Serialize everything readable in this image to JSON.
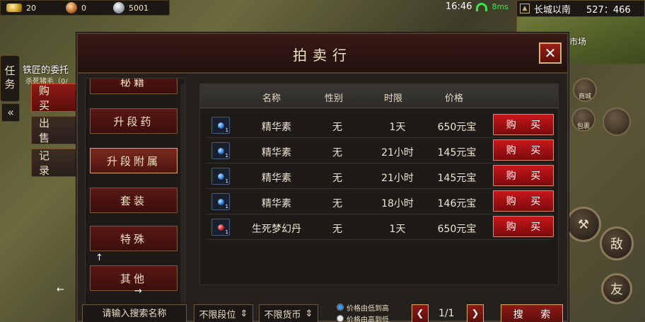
{
  "hud": {
    "gold": "20",
    "copper": "0",
    "silver": "5001",
    "time": "16:46",
    "ping": "8ms",
    "location": "长城以南",
    "coords": "527：466",
    "minimap_label": "市场"
  },
  "left": {
    "task_tab": "任务",
    "quest_title": "铁匠的委托",
    "quest_sub": "杀死猪毛（0/",
    "expand": "«",
    "tabs": [
      "购 买",
      "出 售",
      "记 录"
    ]
  },
  "right": {
    "icon1": "商城",
    "icon2": "包裹",
    "icon3": "",
    "enemy_btn": "敌",
    "friend_btn": "友"
  },
  "panel": {
    "title": "拍卖行",
    "close": "✕",
    "categories": [
      "秘籍",
      "升段药",
      "升段附属",
      "套装",
      "特殊",
      "其他"
    ],
    "arrow_up": "↑",
    "arrow_left": "←",
    "arrow_right": "→",
    "columns": [
      "名称",
      "性别",
      "时限",
      "价格"
    ],
    "rows": [
      {
        "qty": "1",
        "name": "精华素",
        "gender": "无",
        "time": "1天",
        "price": "650元宝",
        "buy": "购 买"
      },
      {
        "qty": "1",
        "name": "精华素",
        "gender": "无",
        "time": "21小时",
        "price": "145元宝",
        "buy": "购 买"
      },
      {
        "qty": "1",
        "name": "精华素",
        "gender": "无",
        "time": "21小时",
        "price": "145元宝",
        "buy": "购 买"
      },
      {
        "qty": "1",
        "name": "精华素",
        "gender": "无",
        "time": "18小时",
        "price": "146元宝",
        "buy": "购 买"
      },
      {
        "qty": "1",
        "name": "生死梦幻丹",
        "gender": "无",
        "time": "1天",
        "price": "650元宝",
        "buy": "购 买"
      }
    ],
    "search_placeholder": "请输入搜索名称",
    "level_filter": "不限段位",
    "currency_filter": "不限货币",
    "sort_asc": "价格由低到高",
    "sort_desc": "价格由高到低",
    "prev": "❮",
    "next": "❯",
    "page": "1/1",
    "search_btn": "搜 索"
  },
  "colors": {
    "accent_red": "#c8161a",
    "panel_bg": "#24201c",
    "ping_green": "#39e64a"
  }
}
